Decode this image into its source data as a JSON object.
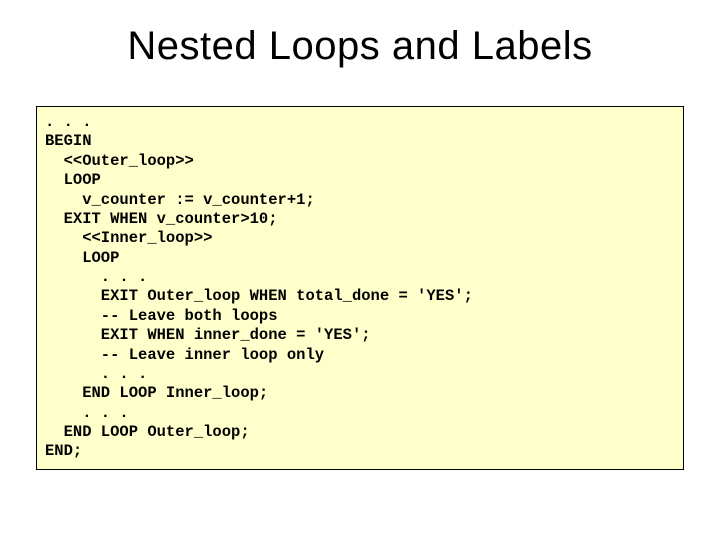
{
  "title": "Nested Loops and Labels",
  "code": ". . .\nBEGIN\n  <<Outer_loop>>\n  LOOP\n    v_counter := v_counter+1;\n  EXIT WHEN v_counter>10;\n    <<Inner_loop>>\n    LOOP\n      . . .\n      EXIT Outer_loop WHEN total_done = 'YES';\n      -- Leave both loops\n      EXIT WHEN inner_done = 'YES';\n      -- Leave inner loop only\n      . . .\n    END LOOP Inner_loop;\n    . . .\n  END LOOP Outer_loop;\nEND;"
}
